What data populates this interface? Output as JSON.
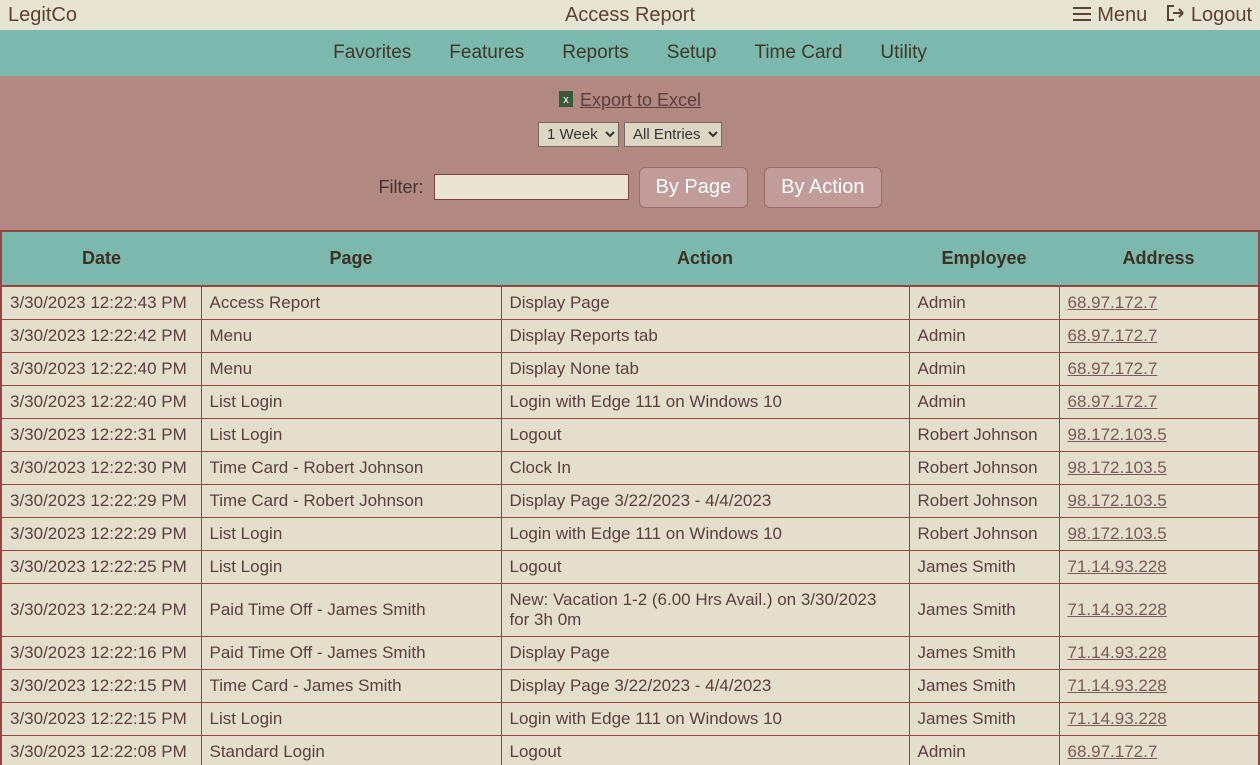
{
  "header": {
    "brand": "LegitCo",
    "title": "Access Report",
    "menu_label": "Menu",
    "logout_label": "Logout"
  },
  "nav": [
    "Favorites",
    "Features",
    "Reports",
    "Setup",
    "Time Card",
    "Utility"
  ],
  "controls": {
    "export_label": "Export to Excel",
    "period_options": [
      "1 Week"
    ],
    "period_selected": "1 Week",
    "entries_options": [
      "All Entries"
    ],
    "entries_selected": "All Entries",
    "filter_label": "Filter:",
    "filter_value": "",
    "btn_by_page": "By Page",
    "btn_by_action": "By Action"
  },
  "table": {
    "columns": [
      "Date",
      "Page",
      "Action",
      "Employee",
      "Address"
    ],
    "rows": [
      {
        "date": "3/30/2023 12:22:43 PM",
        "page": "Access Report",
        "action": "Display Page",
        "employee": "Admin",
        "address": "68.97.172.7"
      },
      {
        "date": "3/30/2023 12:22:42 PM",
        "page": "Menu",
        "action": "Display Reports tab",
        "employee": "Admin",
        "address": "68.97.172.7"
      },
      {
        "date": "3/30/2023 12:22:40 PM",
        "page": "Menu",
        "action": "Display None tab",
        "employee": "Admin",
        "address": "68.97.172.7"
      },
      {
        "date": "3/30/2023 12:22:40 PM",
        "page": "List Login",
        "action": "Login with Edge 111 on Windows 10",
        "employee": "Admin",
        "address": "68.97.172.7"
      },
      {
        "date": "3/30/2023 12:22:31 PM",
        "page": "List Login",
        "action": "Logout",
        "employee": "Robert Johnson",
        "address": "98.172.103.5"
      },
      {
        "date": "3/30/2023 12:22:30 PM",
        "page": "Time Card - Robert Johnson",
        "action": "Clock In",
        "employee": "Robert Johnson",
        "address": "98.172.103.5"
      },
      {
        "date": "3/30/2023 12:22:29 PM",
        "page": "Time Card - Robert Johnson",
        "action": "Display Page 3/22/2023 - 4/4/2023",
        "employee": "Robert Johnson",
        "address": "98.172.103.5"
      },
      {
        "date": "3/30/2023 12:22:29 PM",
        "page": "List Login",
        "action": "Login with Edge 111 on Windows 10",
        "employee": "Robert Johnson",
        "address": "98.172.103.5"
      },
      {
        "date": "3/30/2023 12:22:25 PM",
        "page": "List Login",
        "action": "Logout",
        "employee": "James Smith",
        "address": "71.14.93.228"
      },
      {
        "date": "3/30/2023 12:22:24 PM",
        "page": "Paid Time Off - James Smith",
        "action": "New: Vacation 1-2 (6.00 Hrs Avail.) on 3/30/2023 for 3h 0m",
        "employee": "James Smith",
        "address": "71.14.93.228"
      },
      {
        "date": "3/30/2023 12:22:16 PM",
        "page": "Paid Time Off - James Smith",
        "action": "Display Page",
        "employee": "James Smith",
        "address": "71.14.93.228"
      },
      {
        "date": "3/30/2023 12:22:15 PM",
        "page": "Time Card - James Smith",
        "action": "Display Page 3/22/2023 - 4/4/2023",
        "employee": "James Smith",
        "address": "71.14.93.228"
      },
      {
        "date": "3/30/2023 12:22:15 PM",
        "page": "List Login",
        "action": "Login with Edge 111 on Windows 10",
        "employee": "James Smith",
        "address": "71.14.93.228"
      },
      {
        "date": "3/30/2023 12:22:08 PM",
        "page": "Standard Login",
        "action": "Logout",
        "employee": "Admin",
        "address": "68.97.172.7"
      }
    ]
  }
}
